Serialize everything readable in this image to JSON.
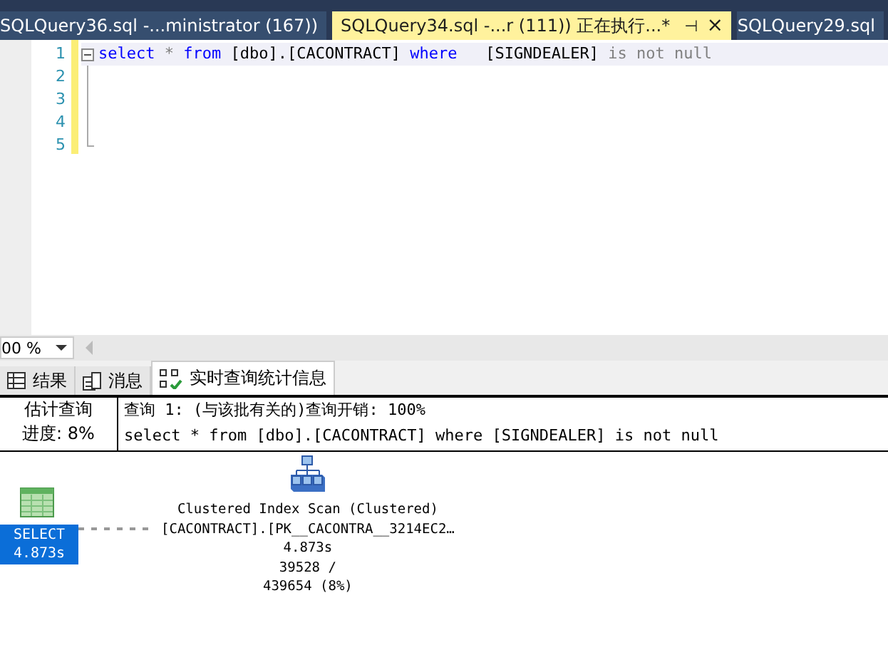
{
  "document_tabs": [
    {
      "label": "SQLQuery36.sql -...ministrator (167))",
      "selected": false
    },
    {
      "label": "SQLQuery34.sql -...r (111)) 正在执行...*",
      "selected": true,
      "pin": "⊣",
      "close": "×"
    },
    {
      "label": "SQLQuery29.sql",
      "selected": false
    }
  ],
  "editor": {
    "lines": [
      {
        "number": "1",
        "tokens": [
          {
            "kind": "keyword",
            "text": "select"
          },
          {
            "kind": "operator",
            "text": " * "
          },
          {
            "kind": "keyword",
            "text": "from"
          },
          {
            "kind": "plain",
            "text": " [dbo].[CACONTRACT] "
          },
          {
            "kind": "keyword",
            "text": "where"
          },
          {
            "kind": "plain",
            "text": "   [SIGNDEALER] "
          },
          {
            "kind": "operator",
            "text": "is not null"
          }
        ]
      },
      {
        "number": "2"
      },
      {
        "number": "3"
      },
      {
        "number": "4"
      },
      {
        "number": "5"
      }
    ]
  },
  "zoom": {
    "value": "00 %"
  },
  "result_tabs": [
    {
      "label": "结果",
      "kind": "grid",
      "selected": false
    },
    {
      "label": "消息",
      "kind": "messages",
      "selected": false
    },
    {
      "label": "实时查询统计信息",
      "kind": "live",
      "selected": true
    }
  ],
  "progress": {
    "label": "估计查询",
    "value": "进度: 8%"
  },
  "query_header": {
    "cost": "查询 1: (与该批有关的)查询开销: 100%",
    "statement": "select * from [dbo].[CACONTRACT] where [SIGNDEALER] is not null"
  },
  "plan": {
    "select_node": {
      "title": "SELECT",
      "time": "4.873s"
    },
    "scan_node": {
      "title": "Clustered Index Scan (Clustered)",
      "object": "[CACONTRACT].[PK__CACONTRA__3214EC2…",
      "time": "4.873s",
      "rows": "39528 /",
      "estimate": "439654 (8%)"
    }
  }
}
